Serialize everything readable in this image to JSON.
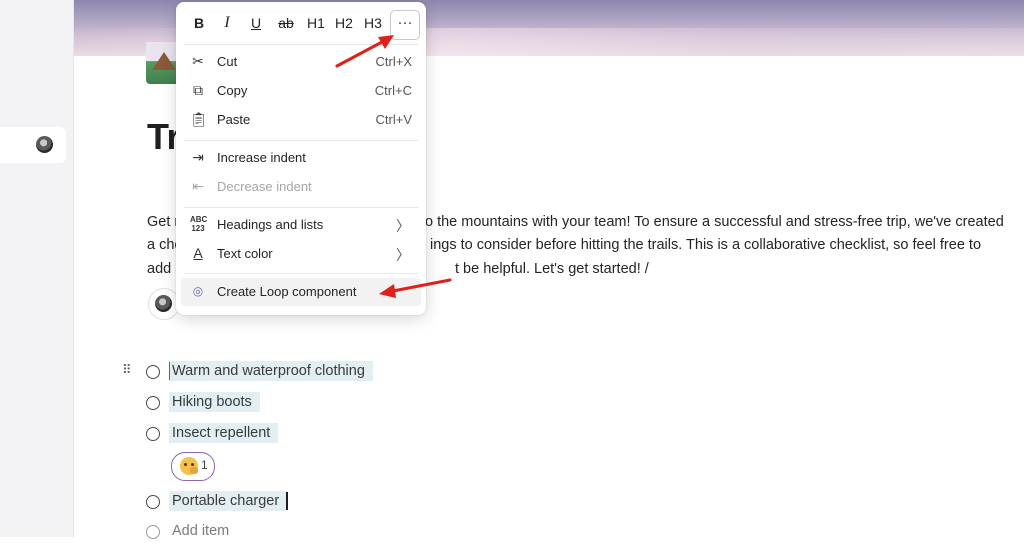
{
  "page": {
    "title": "Tr",
    "body_lines": [
      "Get r",
      "o the mountains with your team! To ensure a successful and stress-free trip, we've created",
      "a che",
      "ings to consider before hitting the trails. This is a collaborative checklist, so feel free to",
      "add",
      "t be helpful. Let's get started!  /"
    ]
  },
  "checklist": {
    "items": [
      {
        "label": "Warm and waterproof clothing"
      },
      {
        "label": "Hiking boots"
      },
      {
        "label": "Insect repellent"
      },
      {
        "label": "Portable charger"
      }
    ],
    "reaction_count": "1",
    "add_item": "Add item"
  },
  "format_bar": {
    "bold": "B",
    "italic": "I",
    "underline": "U",
    "strikethrough": "ab",
    "h1": "H1",
    "h2": "H2",
    "h3": "H3",
    "more": "···"
  },
  "menu": {
    "cut": {
      "label": "Cut",
      "shortcut": "Ctrl+X"
    },
    "copy": {
      "label": "Copy",
      "shortcut": "Ctrl+C"
    },
    "paste": {
      "label": "Paste",
      "shortcut": "Ctrl+V"
    },
    "increase_indent": {
      "label": "Increase indent"
    },
    "decrease_indent": {
      "label": "Decrease indent"
    },
    "headings_lists": {
      "label": "Headings and lists"
    },
    "text_color": {
      "label": "Text color"
    },
    "create_loop": {
      "label": "Create Loop component"
    }
  },
  "colors": {
    "accent_arrow": "#e0201a",
    "reaction_border": "#8b64b8",
    "checklist_highlight": "#e3eef3"
  }
}
